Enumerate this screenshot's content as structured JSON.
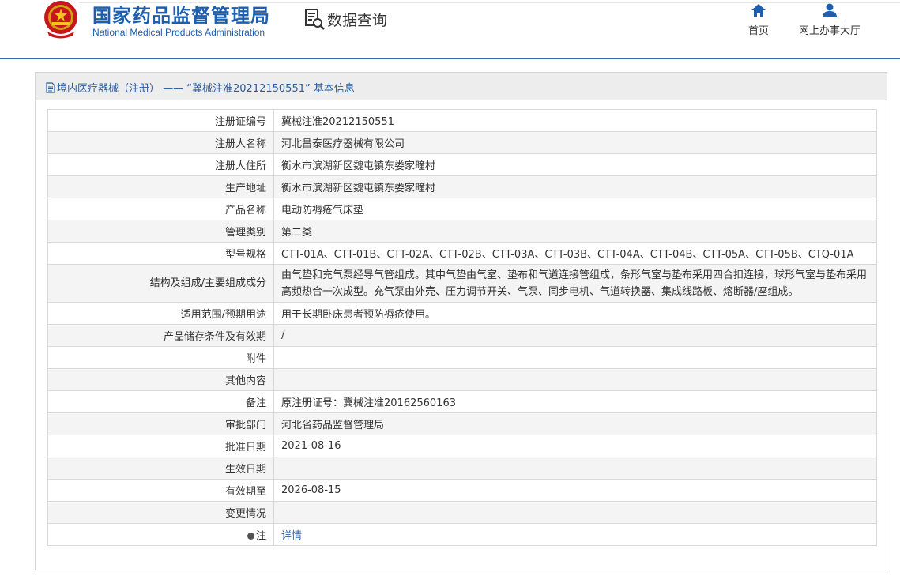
{
  "header": {
    "site_title_cn": "国家药品监督管理局",
    "site_title_en": "National Medical Products Administration",
    "db_query_label": "数据查询",
    "nav": [
      {
        "label": "首页",
        "icon": "home-icon"
      },
      {
        "label": "网上办事大厅",
        "icon": "user-icon"
      }
    ],
    "brand_color": "#1d5fae"
  },
  "panel": {
    "title": "境内医疗器械（注册） —— “冀械注准20212150551” 基本信息"
  },
  "rows": [
    {
      "label": "注册证编号",
      "value": "冀械注准20212150551"
    },
    {
      "label": "注册人名称",
      "value": "河北昌泰医疗器械有限公司"
    },
    {
      "label": "注册人住所",
      "value": "衡水市滨湖新区魏屯镇东娄家疃村"
    },
    {
      "label": "生产地址",
      "value": "衡水市滨湖新区魏屯镇东娄家疃村"
    },
    {
      "label": "产品名称",
      "value": "电动防褥疮气床垫"
    },
    {
      "label": "管理类别",
      "value": "第二类"
    },
    {
      "label": "型号规格",
      "value": "CTT-01A、CTT-01B、CTT-02A、CTT-02B、CTT-03A、CTT-03B、CTT-04A、CTT-04B、CTT-05A、CTT-05B、CTQ-01A"
    },
    {
      "label": "结构及组成/主要组成成分",
      "value": "由气垫和充气泵经导气管组成。其中气垫由气室、垫布和气道连接管组成，条形气室与垫布采用四合扣连接，球形气室与垫布采用高频热合一次成型。充气泵由外壳、压力调节开关、气泵、同步电机、气道转换器、集成线路板、熔断器/座组成。"
    },
    {
      "label": "适用范围/预期用途",
      "value": "用于长期卧床患者预防褥疮使用。"
    },
    {
      "label": "产品储存条件及有效期",
      "value": "/"
    },
    {
      "label": "附件",
      "value": ""
    },
    {
      "label": "其他内容",
      "value": ""
    },
    {
      "label": "备注",
      "value": "原注册证号：冀械注准20162560163"
    },
    {
      "label": "审批部门",
      "value": "河北省药品监督管理局"
    },
    {
      "label": "批准日期",
      "value": "2021-08-16"
    },
    {
      "label": "生效日期",
      "value": ""
    },
    {
      "label": "有效期至",
      "value": "2026-08-15"
    },
    {
      "label": "变更情况",
      "value": ""
    }
  ],
  "note_row": {
    "label": "注",
    "link": "详情"
  }
}
